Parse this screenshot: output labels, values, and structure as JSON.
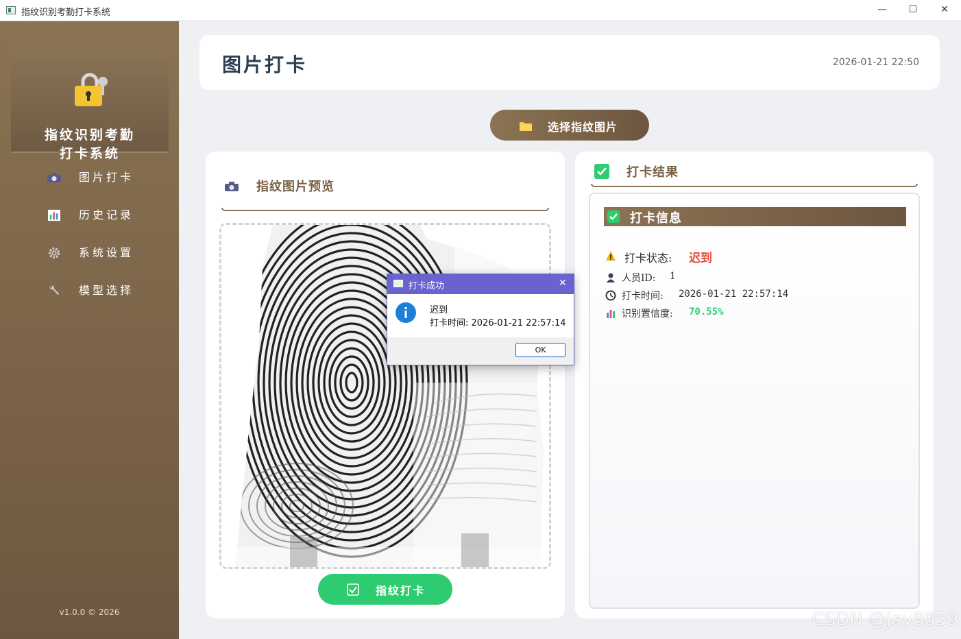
{
  "window": {
    "title": "指纹识别考勤打卡系统",
    "minimize": "—",
    "maximize": "☐",
    "close": "✕"
  },
  "sidebar": {
    "brand_line1": "指纹识别考勤",
    "brand_line2": "打卡系统",
    "items": [
      {
        "label": "图片打卡",
        "icon": "camera-icon"
      },
      {
        "label": "历史记录",
        "icon": "bar-chart-icon"
      },
      {
        "label": "系统设置",
        "icon": "gear-icon"
      },
      {
        "label": "模型选择",
        "icon": "wrench-icon"
      }
    ],
    "version": "v1.0.0 © 2026"
  },
  "header": {
    "title": "图片打卡",
    "datetime": "2026-01-21 22:50"
  },
  "actions": {
    "choose_image": "选择指纹图片",
    "punch": "指纹打卡"
  },
  "preview": {
    "title": "指纹图片预览"
  },
  "result": {
    "title": "打卡结果",
    "info_title": "打卡信息",
    "status_label": "打卡状态:",
    "status_value": "迟到",
    "id_label": "人员ID:",
    "id_value": "1",
    "time_label": "打卡时间:",
    "time_value": "2026-01-21 22:57:14",
    "confidence_label": "识别置信度:",
    "confidence_value": "70.55%"
  },
  "dialog": {
    "title": "打卡成功",
    "line1": "迟到",
    "line2": "打卡时间: 2026-01-21 22:57:14",
    "ok": "OK"
  },
  "colors": {
    "brand_brown": "#7d6549",
    "success_green": "#2ecc71",
    "late_red": "#e74c3c",
    "dialog_purple": "#6a62cf"
  },
  "watermark": "CSDN @Jay8059"
}
